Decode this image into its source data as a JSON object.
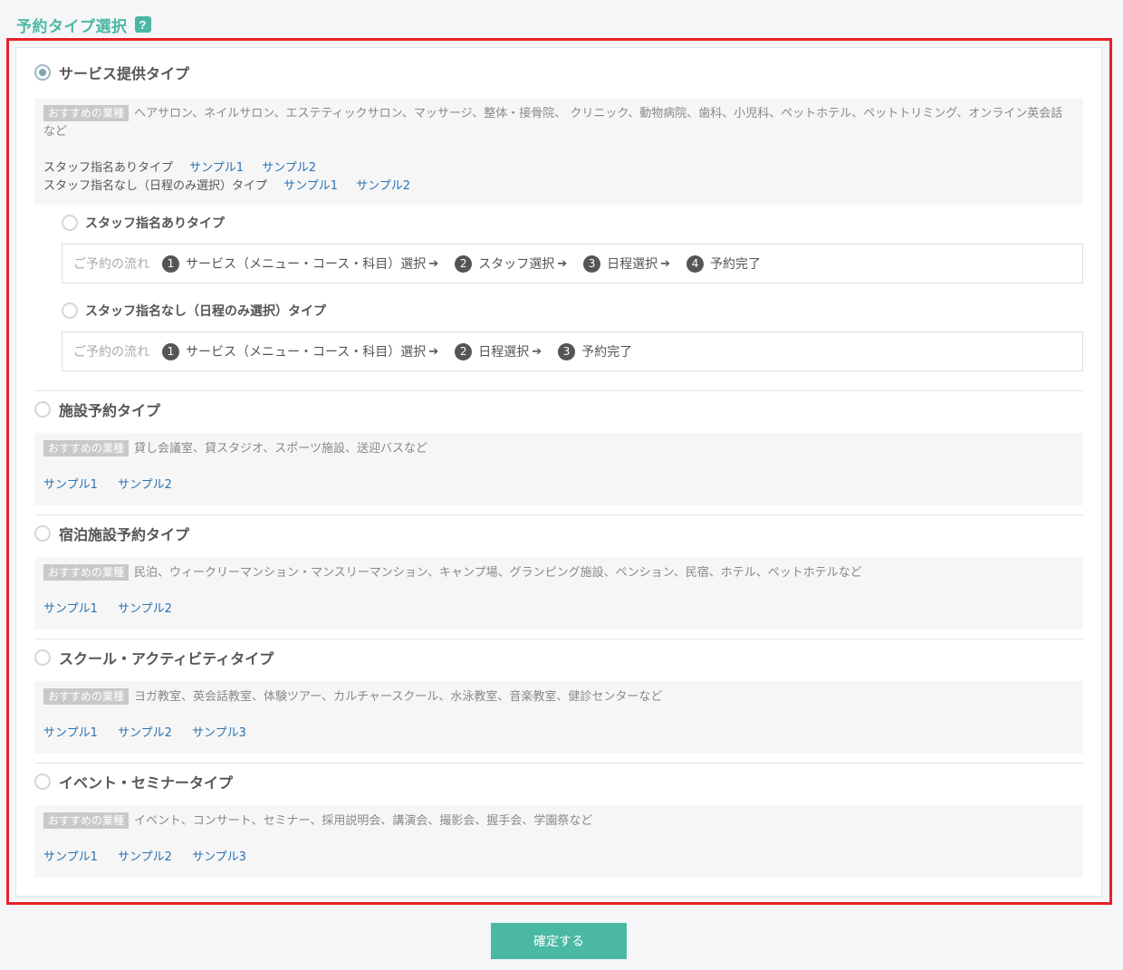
{
  "page": {
    "title": "予約タイプ選択",
    "help_symbol": "?",
    "confirm_label": "確定する",
    "colors": {
      "accent": "#4bb8a4",
      "highlight_frame": "#e8202a",
      "link": "#2a72b5"
    }
  },
  "tag_label": "おすすめの業種",
  "flow_label": "ご予約の流れ",
  "service": {
    "title": "サービス提供タイプ",
    "selected": true,
    "desc_line1": "ヘアサロン、ネイルサロン、エステティックサロン、マッサージ、整体・接骨院、 クリニック、動物病院、歯科、小児科、ペットホテル、ペットトリミング、オンライン英会話",
    "desc_line2": "など",
    "sample_rows": [
      {
        "label": "スタッフ指名ありタイプ",
        "links": [
          "サンプル1",
          "サンプル2"
        ]
      },
      {
        "label": "スタッフ指名なし（日程のみ選択）タイプ",
        "links": [
          "サンプル1",
          "サンプル2"
        ]
      }
    ],
    "sub_with_staff": {
      "title": "スタッフ指名ありタイプ",
      "steps": [
        {
          "num": "1",
          "text": "サービス（メニュー・コース・科目）選択"
        },
        {
          "num": "2",
          "text": "スタッフ選択"
        },
        {
          "num": "3",
          "text": "日程選択"
        },
        {
          "num": "4",
          "text": "予約完了"
        }
      ]
    },
    "sub_no_staff": {
      "title": "スタッフ指名なし（日程のみ選択）タイプ",
      "steps": [
        {
          "num": "1",
          "text": "サービス（メニュー・コース・科目）選択"
        },
        {
          "num": "2",
          "text": "日程選択"
        },
        {
          "num": "3",
          "text": "予約完了"
        }
      ]
    }
  },
  "facility": {
    "title": "施設予約タイプ",
    "desc": "貸し会議室、貸スタジオ、スポーツ施設、送迎バスなど",
    "links": [
      "サンプル1",
      "サンプル2"
    ]
  },
  "lodging": {
    "title": "宿泊施設予約タイプ",
    "desc": "民泊、ウィークリーマンション・マンスリーマンション、キャンプ場、グランピング施設、ペンション、民宿、ホテル、ペットホテルなど",
    "links": [
      "サンプル1",
      "サンプル2"
    ]
  },
  "school": {
    "title": "スクール・アクティビティタイプ",
    "desc": "ヨガ教室、英会話教室、体験ツアー、カルチャースクール、水泳教室、音楽教室、健診センターなど",
    "links": [
      "サンプル1",
      "サンプル2",
      "サンプル3"
    ]
  },
  "event": {
    "title": "イベント・セミナータイプ",
    "desc": "イベント、コンサート、セミナー、採用説明会、講演会、撮影会、握手会、学園祭など",
    "links": [
      "サンプル1",
      "サンプル2",
      "サンプル3"
    ]
  }
}
